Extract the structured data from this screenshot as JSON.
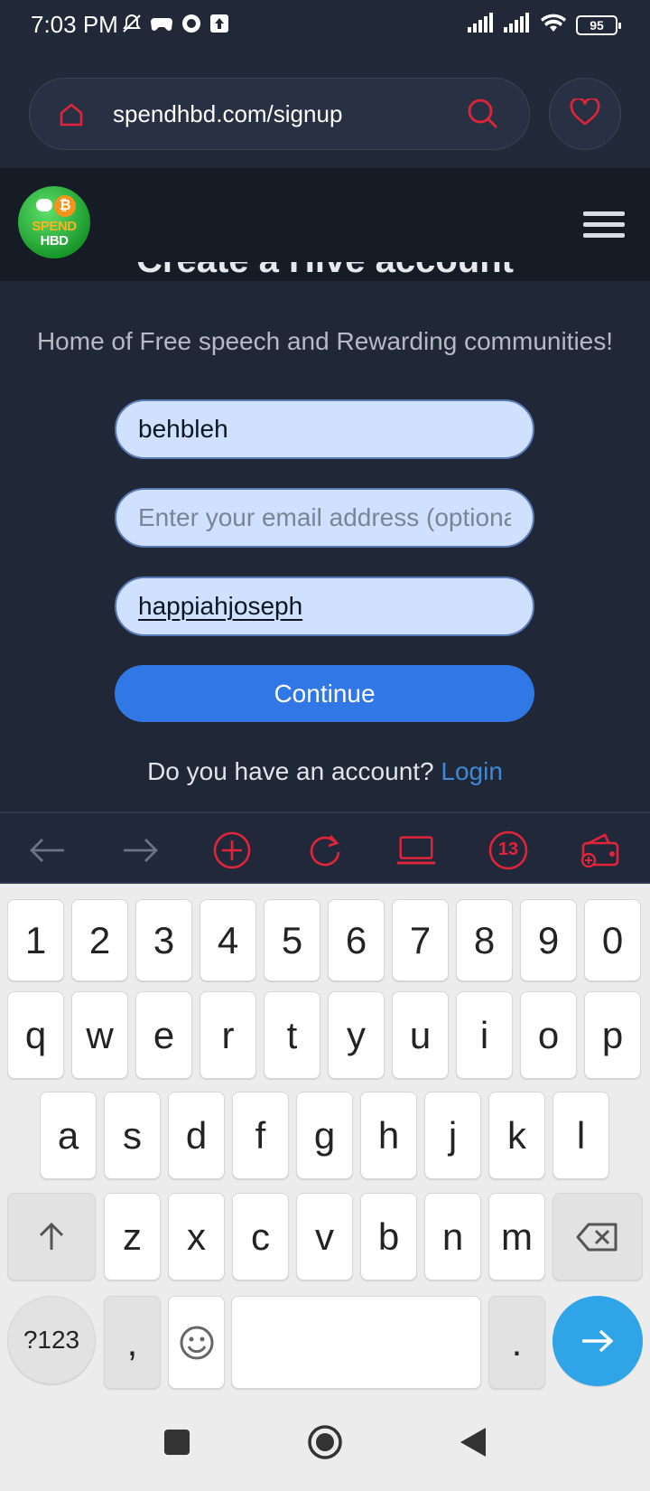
{
  "status_bar": {
    "time": "7:03 PM",
    "battery": "95",
    "icons": [
      "mute-icon",
      "game-icon",
      "chat-icon",
      "upload-icon",
      "signal-icon",
      "signal-icon",
      "wifi-icon",
      "battery-icon"
    ]
  },
  "browser": {
    "url": "spendhbd.com/signup",
    "accent_color": "#e0243a"
  },
  "site": {
    "logo_line1": "SPEND",
    "logo_line2": "HBD",
    "logo_badge": "₿",
    "clipped_title": "Create a Hive account",
    "subtitle": "Home of Free speech and Rewarding communities!",
    "form": {
      "username_value": "behbleh",
      "email_placeholder": "Enter your email address (optional)",
      "referrer_value": "happiahjoseph",
      "continue_label": "Continue"
    },
    "login_prompt": "Do you have an account?",
    "login_link": "Login"
  },
  "toolbar": {
    "tab_count": "13"
  },
  "keyboard": {
    "row_numbers": [
      "1",
      "2",
      "3",
      "4",
      "5",
      "6",
      "7",
      "8",
      "9",
      "0"
    ],
    "row_1": [
      "q",
      "w",
      "e",
      "r",
      "t",
      "y",
      "u",
      "i",
      "o",
      "p"
    ],
    "row_2": [
      "a",
      "s",
      "d",
      "f",
      "g",
      "h",
      "j",
      "k",
      "l"
    ],
    "row_3": [
      "z",
      "x",
      "c",
      "v",
      "b",
      "n",
      "m"
    ],
    "symbols_key": "?123",
    "comma_key": ",",
    "period_key": ".",
    "enter_color": "#2fa4e7"
  }
}
